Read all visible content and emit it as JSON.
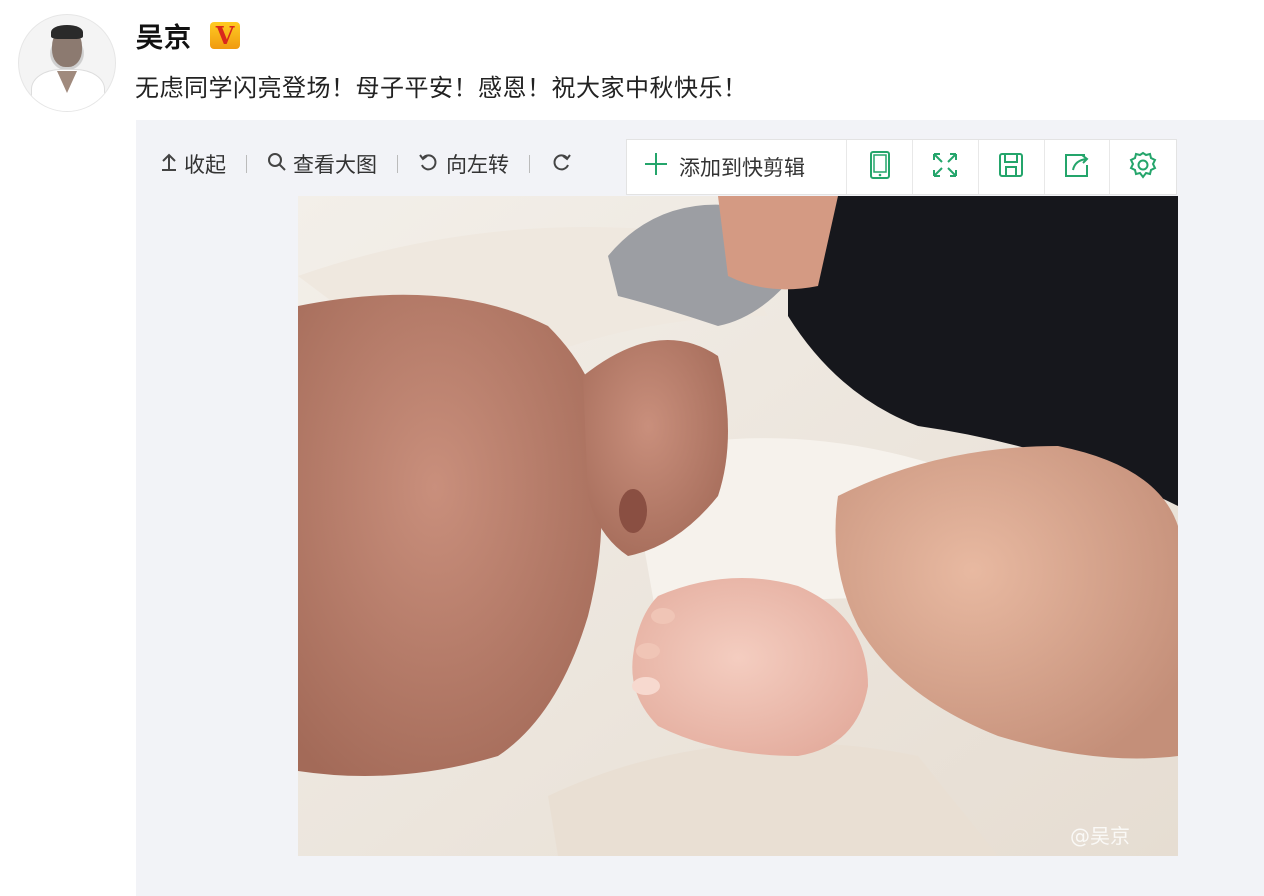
{
  "post": {
    "username": "吴京",
    "verified_badge": "V",
    "text": "无虑同学闪亮登场！母子平安！感恩！祝大家中秋快乐！"
  },
  "image_toolbar": {
    "collapse": {
      "icon": "arrow-up-icon",
      "label": "收起"
    },
    "view_large": {
      "icon": "search-icon",
      "label": "查看大图"
    },
    "rotate_left": {
      "icon": "rotate-left-icon",
      "label": "向左转"
    },
    "rotate_right": {
      "icon": "rotate-right-icon"
    }
  },
  "quick_clip_bar": {
    "add_label": "添加到快剪辑",
    "buttons": [
      "phone-icon",
      "fullscreen-icon",
      "save-icon",
      "share-icon",
      "settings-icon"
    ]
  },
  "photo": {
    "description_alt": "",
    "watermark": "@吴京"
  },
  "colors": {
    "accent_green": "#24a56b",
    "badge_orange": "#f09a10",
    "badge_red": "#d9281c",
    "panel_bg": "#f2f3f7"
  }
}
